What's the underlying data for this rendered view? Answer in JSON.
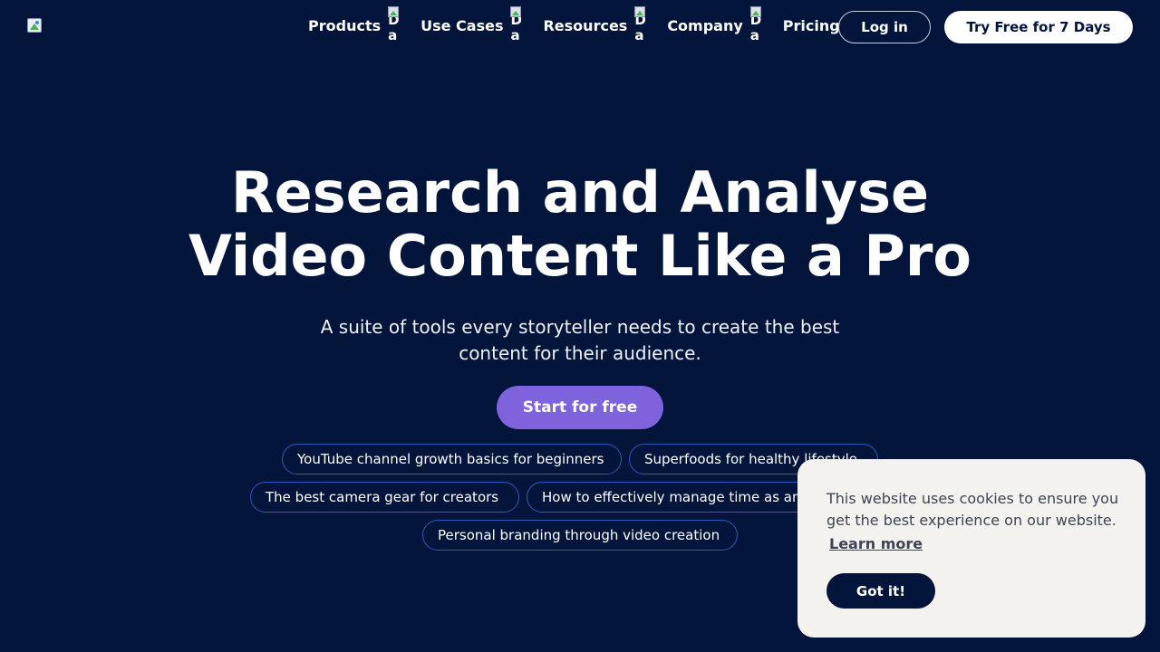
{
  "header": {
    "logo_icon": "broken-image-icon",
    "nav": [
      {
        "label": "Products",
        "icon": "dropdown-arrow-icon",
        "alt_line1": "D",
        "alt_line2": "a"
      },
      {
        "label": "Use Cases",
        "icon": "dropdown-arrow-icon",
        "alt_line1": "D",
        "alt_line2": "a"
      },
      {
        "label": "Resources",
        "icon": "dropdown-arrow-icon",
        "alt_line1": "D",
        "alt_line2": "a"
      },
      {
        "label": "Company",
        "icon": "dropdown-arrow-icon",
        "alt_line1": "D",
        "alt_line2": "a"
      },
      {
        "label": "Pricing"
      }
    ],
    "login_label": "Log in",
    "trial_label": "Try Free for 7 Days"
  },
  "hero": {
    "title_line1": "Research and Analyse",
    "title_line2": "Video Content Like a Pro",
    "subtitle": "A suite of tools every storyteller needs to create the best content for their audience.",
    "cta_label": "Start for free",
    "suggestions": [
      "YouTube channel growth basics for beginners",
      "Superfoods for healthy lifestyle",
      "The best camera gear for creators",
      "How to effectively manage time as an entrepreneur",
      "Personal branding through video creation"
    ]
  },
  "cookie_banner": {
    "message": "This website uses cookies to ensure you get the best experience on our website.",
    "learn_more_label": "Learn more",
    "accept_label": "Got it!"
  },
  "colors": {
    "background": "#03153b",
    "cta": "#7f63dd",
    "chip_border": "#3257b8",
    "banner_bg": "#f4f2ee",
    "banner_button": "#03153b"
  }
}
